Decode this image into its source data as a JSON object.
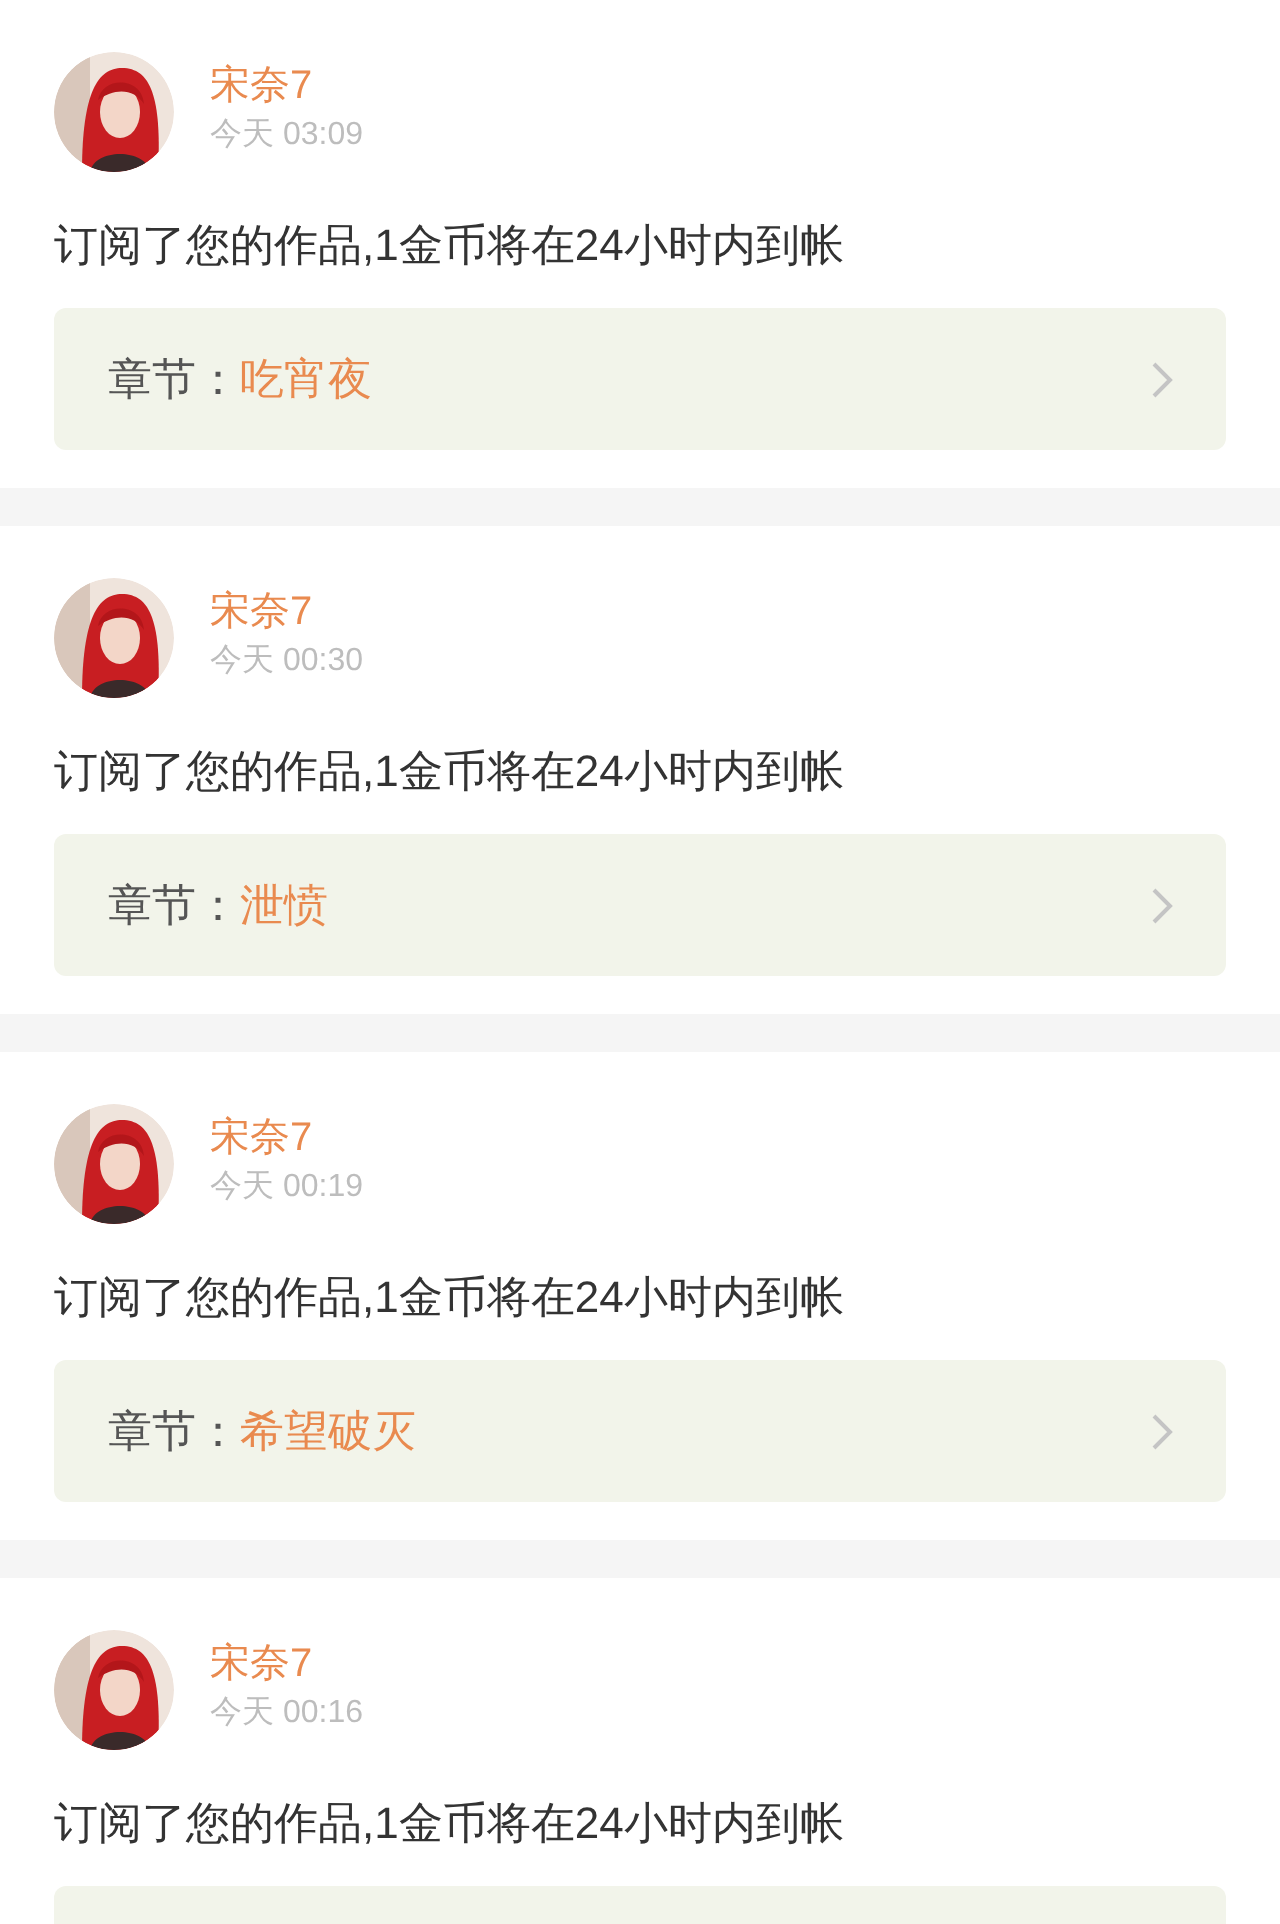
{
  "notifications": [
    {
      "user": "宋奈7",
      "time": "今天 03:09",
      "message": "订阅了您的作品,1金币将在24小时内到帐",
      "chapter_label": "章节：",
      "chapter": "吃宵夜"
    },
    {
      "user": "宋奈7",
      "time": "今天 00:30",
      "message": "订阅了您的作品,1金币将在24小时内到帐",
      "chapter_label": "章节：",
      "chapter": "泄愤"
    },
    {
      "user": "宋奈7",
      "time": "今天 00:19",
      "message": "订阅了您的作品,1金币将在24小时内到帐",
      "chapter_label": "章节：",
      "chapter": "希望破灭"
    },
    {
      "user": "宋奈7",
      "time": "今天 00:16",
      "message": "订阅了您的作品,1金币将在24小时内到帐"
    }
  ]
}
